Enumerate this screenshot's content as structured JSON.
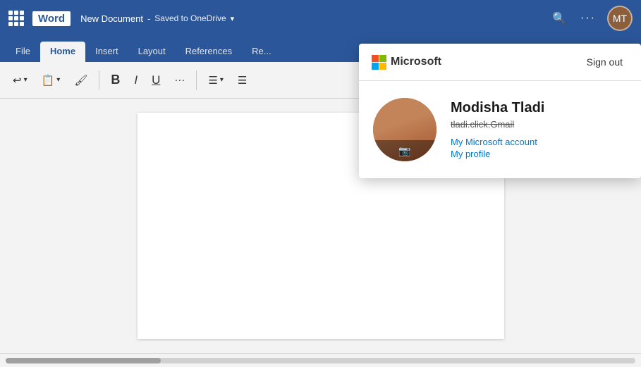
{
  "titlebar": {
    "app_name": "Word",
    "doc_name": "New Document",
    "save_status": "Saved to OneDrive",
    "chevron": "▾",
    "search_icon": "🔍",
    "more_icon": "···"
  },
  "tabs": [
    {
      "label": "File",
      "active": false
    },
    {
      "label": "Home",
      "active": true
    },
    {
      "label": "Insert",
      "active": false
    },
    {
      "label": "Layout",
      "active": false
    },
    {
      "label": "References",
      "active": false
    },
    {
      "label": "Re...",
      "active": false
    }
  ],
  "toolbar": {
    "undo": "↩",
    "undo_chevron": "▾",
    "clipboard": "📋",
    "clipboard_chevron": "▾",
    "format_painter": "🖌",
    "bold": "B",
    "italic": "I",
    "underline": "U",
    "more": "···",
    "list": "≡▾",
    "align": "≡"
  },
  "profile_popup": {
    "ms_label": "Microsoft",
    "sign_out_label": "Sign out",
    "user_name": "Modisha Tladi",
    "user_email": "tladi.click.Gmail",
    "my_account_link": "My Microsoft account",
    "my_profile_link": "My profile"
  }
}
